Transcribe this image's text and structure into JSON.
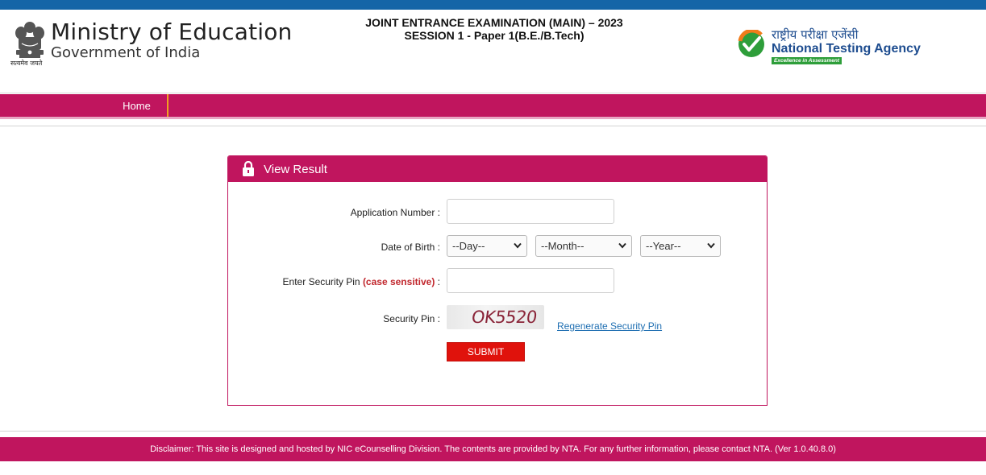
{
  "header": {
    "emblem_caption": "सत्यमेव जयते",
    "ministry_title": "Ministry of Education",
    "ministry_subtitle": "Government of India",
    "exam_title_line1": "JOINT ENTRANCE EXAMINATION (MAIN) – 2023",
    "exam_title_line2": "SESSION 1 - Paper 1(B.E./B.Tech)",
    "nta_hindi": "राष्ट्रीय परीक्षा एजेंसी",
    "nta_english": "National Testing Agency",
    "nta_tagline": "Excellence in Assessment"
  },
  "nav": {
    "home_label": "Home"
  },
  "panel": {
    "title": "View Result",
    "icon": "lock-icon",
    "application_number_label": "Application Number :",
    "application_number_value": "",
    "dob_label": "Date of Birth :",
    "dob_day": "--Day--",
    "dob_month": "--Month--",
    "dob_year": "--Year--",
    "security_pin_label": "Enter Security Pin",
    "security_pin_label_note": "(case sensitive)",
    "security_pin_label_colon": " :",
    "security_pin_value": "",
    "captcha_label": "Security Pin :",
    "captcha_text": "OK5520",
    "regenerate_label": "Regenerate Security Pin",
    "submit_label": "SUBMIT"
  },
  "footer": {
    "disclaimer": "Disclaimer: This site is designed and hosted by NIC eCounselling Division. The contents are provided by NTA. For any further information, please contact NTA. (Ver 1.0.40.8.0)"
  },
  "colors": {
    "brand_magenta": "#c0155e",
    "top_blue": "#1565a7",
    "submit_red": "#e0120c",
    "link_blue": "#1f6fb2"
  }
}
